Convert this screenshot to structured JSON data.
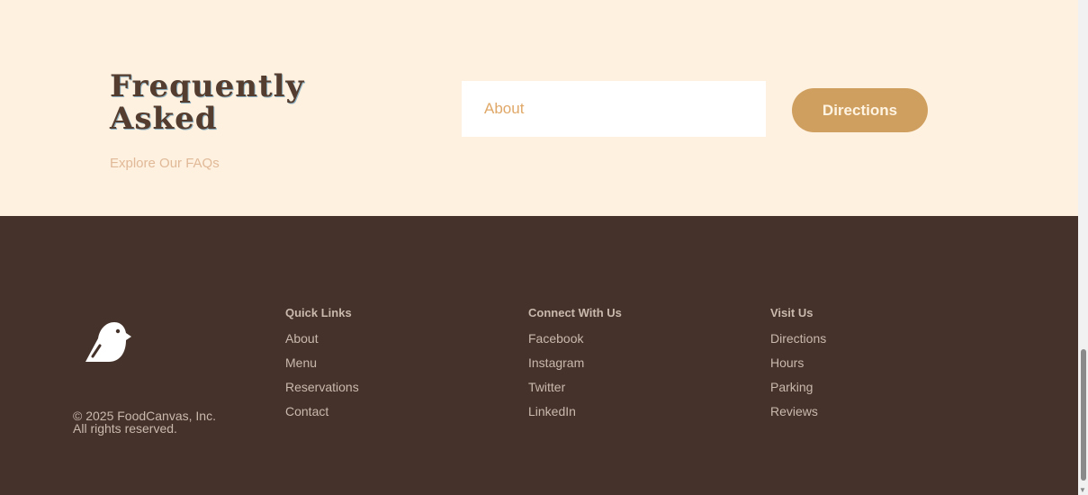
{
  "faq": {
    "title_line1": "Frequently",
    "title_line2": "Asked",
    "subtitle": "Explore Our FAQs",
    "tab_label": "About",
    "button_label": "Directions"
  },
  "footer": {
    "copyright": "© 2025 FoodCanvas, Inc.",
    "rights": "All rights reserved.",
    "columns": [
      {
        "heading": "Quick Links",
        "links": [
          "About",
          "Menu",
          "Reservations",
          "Contact"
        ]
      },
      {
        "heading": "Connect With Us",
        "links": [
          "Facebook",
          "Instagram",
          "Twitter",
          "LinkedIn"
        ]
      },
      {
        "heading": "Visit Us",
        "links": [
          "Directions",
          "Hours",
          "Parking",
          "Reviews"
        ]
      }
    ]
  },
  "colors": {
    "cream": "#fff1df",
    "brown": "#45322b",
    "gold": "#cf9f5f"
  }
}
